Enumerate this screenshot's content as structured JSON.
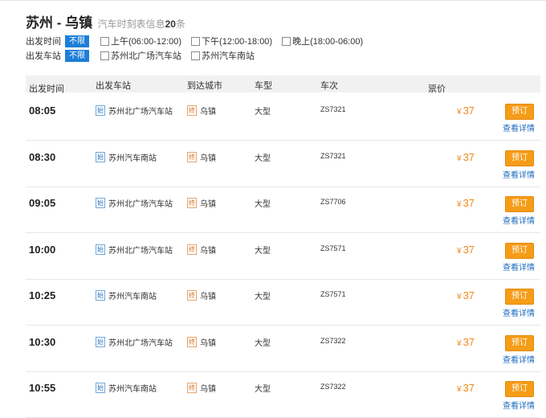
{
  "header": {
    "route": "苏州 - 乌镇",
    "subtitle": "汽车时刻表信息",
    "count": "20",
    "unit": "条"
  },
  "filters": {
    "time": {
      "label": "出发时间",
      "tag": "不限",
      "options": [
        "上午(06:00-12:00)",
        "下午(12:00-18:00)",
        "晚上(18:00-06:00)"
      ]
    },
    "station": {
      "label": "出发车站",
      "tag": "不限",
      "options": [
        "苏州北广场汽车站",
        "苏州汽车南站"
      ]
    }
  },
  "table": {
    "headers": {
      "time": "出发时间",
      "station": "出发车站",
      "city": "到达城市",
      "type": "车型",
      "number": "车次",
      "price": "票价"
    },
    "start_badge": "始",
    "end_badge": "终",
    "currency": "¥",
    "book_label": "预订",
    "detail_label": "查看详情",
    "rows": [
      {
        "time": "08:05",
        "station": "苏州北广场汽车站",
        "city": "乌镇",
        "type": "大型",
        "number": "ZS7321",
        "price": "37"
      },
      {
        "time": "08:30",
        "station": "苏州汽车南站",
        "city": "乌镇",
        "type": "大型",
        "number": "ZS7321",
        "price": "37"
      },
      {
        "time": "09:05",
        "station": "苏州北广场汽车站",
        "city": "乌镇",
        "type": "大型",
        "number": "ZS7706",
        "price": "37"
      },
      {
        "time": "10:00",
        "station": "苏州北广场汽车站",
        "city": "乌镇",
        "type": "大型",
        "number": "ZS7571",
        "price": "37"
      },
      {
        "time": "10:25",
        "station": "苏州汽车南站",
        "city": "乌镇",
        "type": "大型",
        "number": "ZS7571",
        "price": "37"
      },
      {
        "time": "10:30",
        "station": "苏州北广场汽车站",
        "city": "乌镇",
        "type": "大型",
        "number": "ZS7322",
        "price": "37"
      },
      {
        "time": "10:55",
        "station": "苏州汽车南站",
        "city": "乌镇",
        "type": "大型",
        "number": "ZS7322",
        "price": "37"
      }
    ]
  },
  "colors": {
    "accent_blue": "#1d7ed8",
    "price_orange": "#f08a1c",
    "book_button": "#f59c18",
    "link_blue": "#1c6bbf"
  }
}
